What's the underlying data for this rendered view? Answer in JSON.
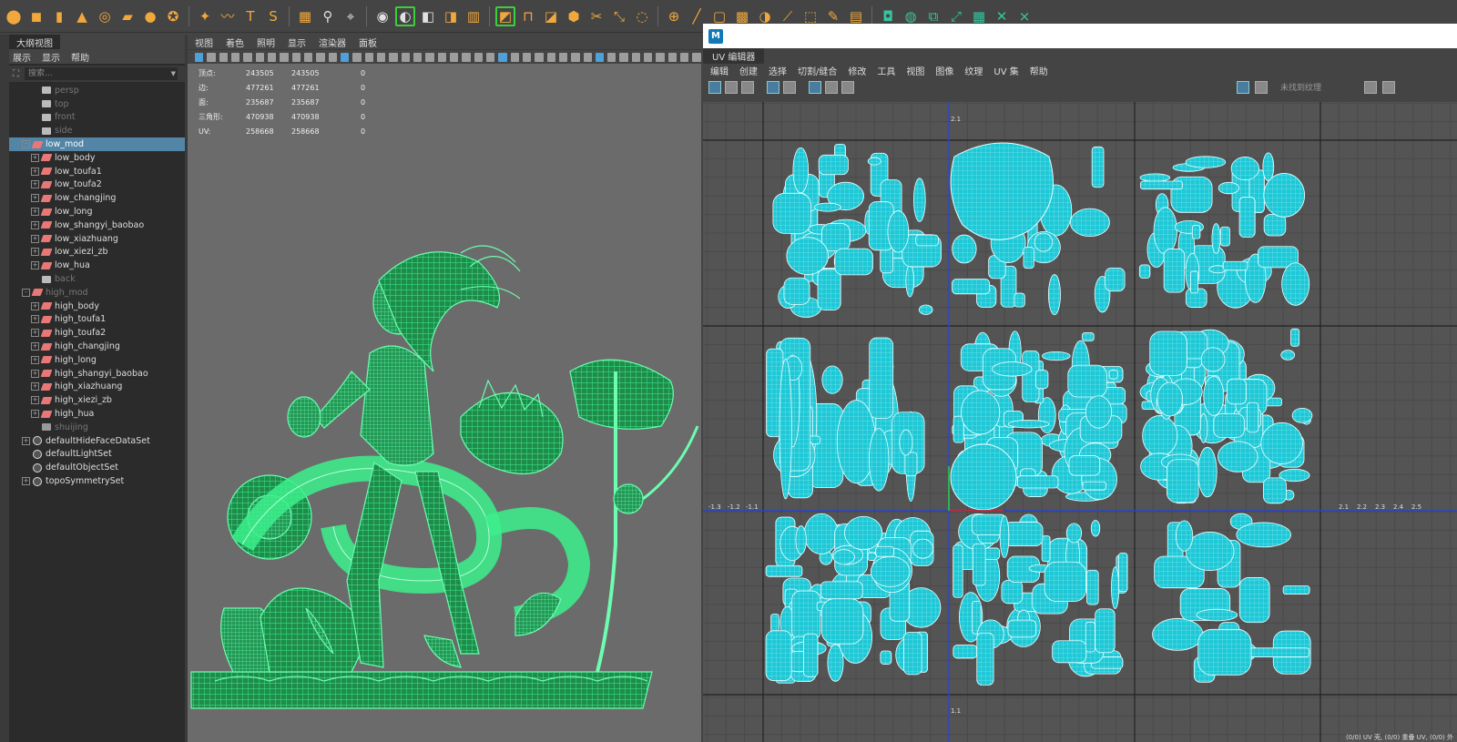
{
  "outliner": {
    "tab": "大纲视图",
    "menu": [
      "展示",
      "显示",
      "帮助"
    ],
    "search_placeholder": "搜索...",
    "items": [
      {
        "label": "persp",
        "kind": "cam",
        "dim": true,
        "indent": 1
      },
      {
        "label": "top",
        "kind": "cam",
        "dim": true,
        "indent": 1
      },
      {
        "label": "front",
        "kind": "cam",
        "dim": true,
        "indent": 1
      },
      {
        "label": "side",
        "kind": "cam",
        "dim": true,
        "indent": 1
      },
      {
        "label": "low_mod",
        "kind": "mesh",
        "selected": true,
        "expand": "-",
        "indent": 0
      },
      {
        "label": "low_body",
        "kind": "mesh",
        "expand": "+",
        "indent": 1
      },
      {
        "label": "low_toufa1",
        "kind": "mesh",
        "expand": "+",
        "indent": 1
      },
      {
        "label": "low_toufa2",
        "kind": "mesh",
        "expand": "+",
        "indent": 1
      },
      {
        "label": "low_changjing",
        "kind": "mesh",
        "expand": "+",
        "indent": 1
      },
      {
        "label": "low_long",
        "kind": "mesh",
        "expand": "+",
        "indent": 1
      },
      {
        "label": "low_shangyi_baobao",
        "kind": "mesh",
        "expand": "+",
        "indent": 1
      },
      {
        "label": "low_xiazhuang",
        "kind": "mesh",
        "expand": "+",
        "indent": 1
      },
      {
        "label": "low_xiezi_zb",
        "kind": "mesh",
        "expand": "+",
        "indent": 1
      },
      {
        "label": "low_hua",
        "kind": "mesh",
        "expand": "+",
        "indent": 1
      },
      {
        "label": "back",
        "kind": "cam",
        "dim": true,
        "indent": 1
      },
      {
        "label": "high_mod",
        "kind": "mesh",
        "dim": true,
        "expand": "-",
        "indent": 0
      },
      {
        "label": "high_body",
        "kind": "mesh",
        "expand": "+",
        "indent": 1
      },
      {
        "label": "high_toufa1",
        "kind": "mesh",
        "expand": "+",
        "indent": 1
      },
      {
        "label": "high_toufa2",
        "kind": "mesh",
        "expand": "+",
        "indent": 1
      },
      {
        "label": "high_changjing",
        "kind": "mesh",
        "expand": "+",
        "indent": 1
      },
      {
        "label": "high_long",
        "kind": "mesh",
        "expand": "+",
        "indent": 1
      },
      {
        "label": "high_shangyi_baobao",
        "kind": "mesh",
        "expand": "+",
        "indent": 1
      },
      {
        "label": "high_xiazhuang",
        "kind": "mesh",
        "expand": "+",
        "indent": 1
      },
      {
        "label": "high_xiezi_zb",
        "kind": "mesh",
        "expand": "+",
        "indent": 1
      },
      {
        "label": "high_hua",
        "kind": "mesh",
        "expand": "+",
        "indent": 1
      },
      {
        "label": "shuijing",
        "kind": "grp",
        "dim": true,
        "indent": 1
      },
      {
        "label": "defaultHideFaceDataSet",
        "kind": "set",
        "expand": "+",
        "indent": 0
      },
      {
        "label": "defaultLightSet",
        "kind": "set",
        "indent": 0
      },
      {
        "label": "defaultObjectSet",
        "kind": "set",
        "indent": 0
      },
      {
        "label": "topoSymmetrySet",
        "kind": "set",
        "expand": "+",
        "indent": 0
      }
    ]
  },
  "viewport": {
    "menu": [
      "视图",
      "着色",
      "照明",
      "显示",
      "渲染器",
      "面板"
    ],
    "hud": [
      {
        "k": "顶点:",
        "v1": "243505",
        "v2": "243505",
        "v3": "0"
      },
      {
        "k": "边:",
        "v1": "477261",
        "v2": "477261",
        "v3": "0"
      },
      {
        "k": "面:",
        "v1": "235687",
        "v2": "235687",
        "v3": "0"
      },
      {
        "k": "三角形:",
        "v1": "470938",
        "v2": "470938",
        "v3": "0"
      },
      {
        "k": "UV:",
        "v1": "258668",
        "v2": "258668",
        "v3": "0"
      }
    ],
    "wire_color": "#3cf08c"
  },
  "uv_editor": {
    "logo": "M",
    "tab": "UV 编辑器",
    "menu": [
      "编辑",
      "创建",
      "选择",
      "切割/缝合",
      "修改",
      "工具",
      "视图",
      "图像",
      "纹理",
      "UV 集",
      "帮助"
    ],
    "texture_placeholder": "未找到纹理",
    "axis_labels_x": [
      "-1.3",
      "-1.2",
      "-1.1",
      "2.1",
      "2.2",
      "2.3",
      "2.4",
      "2.5"
    ],
    "axis_labels_y": [
      "2.1",
      "1.1"
    ],
    "status": "(0/0) UV 壳, (0/0) 重叠 UV, (0/0) 外",
    "shell_color": "#1fc8d6",
    "bg_color": "#545454"
  },
  "shelf": {
    "icons": [
      "sphere",
      "cube",
      "cylinder",
      "cone",
      "torus",
      "plane",
      "disc",
      "soccer",
      "star",
      "path",
      "text",
      "svg",
      "grid",
      "pivot",
      "snap-xyz",
      "ref",
      "mirror",
      "combine",
      "extract",
      "separate",
      "bevel",
      "bridge",
      "fill",
      "extrude",
      "multicut",
      "transform",
      "smooth",
      "boolean",
      "ruler",
      "poly",
      "cube-grid",
      "mirror2",
      "knife",
      "frame",
      "draw",
      "uv-planar",
      "uv-cyl",
      "uv-sphere",
      "uv-auto",
      "uv-unfold",
      "uv-layout",
      "uv-cut",
      "uv-sew"
    ]
  }
}
